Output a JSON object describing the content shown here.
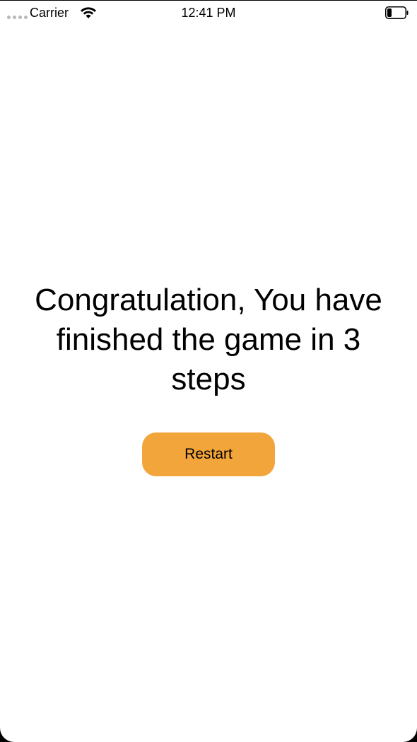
{
  "status_bar": {
    "carrier": "Carrier",
    "time": "12:41 PM",
    "signal_icon": "signal-dots-icon",
    "wifi_icon": "wifi-icon",
    "battery_icon": "battery-icon",
    "battery_level": 0.25
  },
  "main": {
    "message": "Congratulation, You have finished the game in 3 steps",
    "restart_label": "Restart"
  },
  "colors": {
    "accent": "#f2a53a",
    "background": "#ffffff",
    "text": "#000000"
  }
}
